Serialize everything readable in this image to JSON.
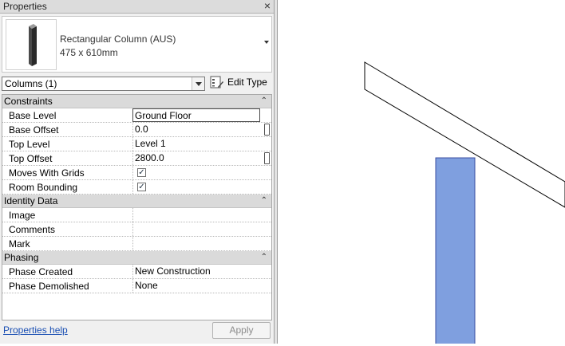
{
  "panel": {
    "title": "Properties",
    "close": "×"
  },
  "type_selector": {
    "family": "Rectangular Column (AUS)",
    "type": "475 x 610mm"
  },
  "filter": {
    "selected": "Columns (1)"
  },
  "edit_type": {
    "label": "Edit Type"
  },
  "sections": {
    "constraints": {
      "label": "Constraints",
      "rows": {
        "base_level": {
          "name": "Base Level",
          "value": "Ground Floor"
        },
        "base_offset": {
          "name": "Base Offset",
          "value": "0.0"
        },
        "top_level": {
          "name": "Top Level",
          "value": "Level 1"
        },
        "top_offset": {
          "name": "Top Offset",
          "value": "2800.0"
        },
        "moves_with_grids": {
          "name": "Moves With Grids",
          "checked": true
        },
        "room_bounding": {
          "name": "Room Bounding",
          "checked": true
        }
      }
    },
    "identity": {
      "label": "Identity Data",
      "rows": {
        "image": {
          "name": "Image",
          "value": ""
        },
        "comments": {
          "name": "Comments",
          "value": ""
        },
        "mark": {
          "name": "Mark",
          "value": ""
        }
      }
    },
    "phasing": {
      "label": "Phasing",
      "rows": {
        "phase_created": {
          "name": "Phase Created",
          "value": "New Construction"
        },
        "phase_demolished": {
          "name": "Phase Demolished",
          "value": "None"
        }
      }
    }
  },
  "footer": {
    "help_link": "Properties help",
    "apply": "Apply"
  },
  "check_glyph": "✓",
  "collapse_glyph": "⌃",
  "colors": {
    "column_fill": "#7f9fdf",
    "column_stroke": "#3b4fa0",
    "link": "#1a4fb3"
  }
}
